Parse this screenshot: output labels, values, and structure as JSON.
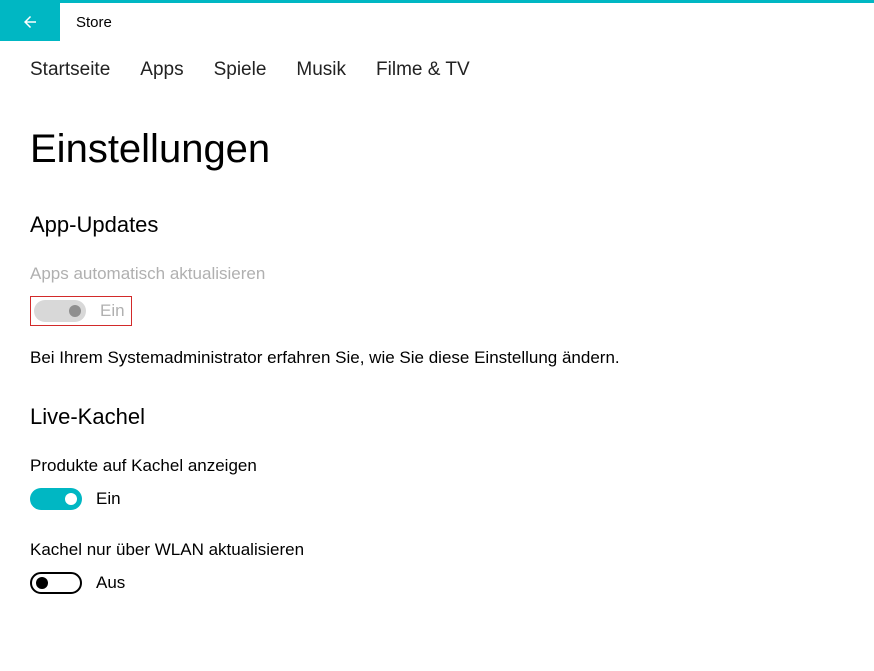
{
  "header": {
    "app_title": "Store"
  },
  "nav": {
    "tabs": [
      "Startseite",
      "Apps",
      "Spiele",
      "Musik",
      "Filme & TV"
    ]
  },
  "page": {
    "title": "Einstellungen"
  },
  "sections": {
    "app_updates": {
      "heading": "App-Updates",
      "label": "Apps automatisch aktualisieren",
      "state": "Ein",
      "info": "Bei Ihrem Systemadministrator erfahren Sie, wie Sie diese Einstellung ändern."
    },
    "live_tile": {
      "heading": "Live-Kachel",
      "setting1_label": "Produkte auf Kachel anzeigen",
      "setting1_state": "Ein",
      "setting2_label": "Kachel nur über WLAN aktualisieren",
      "setting2_state": "Aus"
    }
  }
}
